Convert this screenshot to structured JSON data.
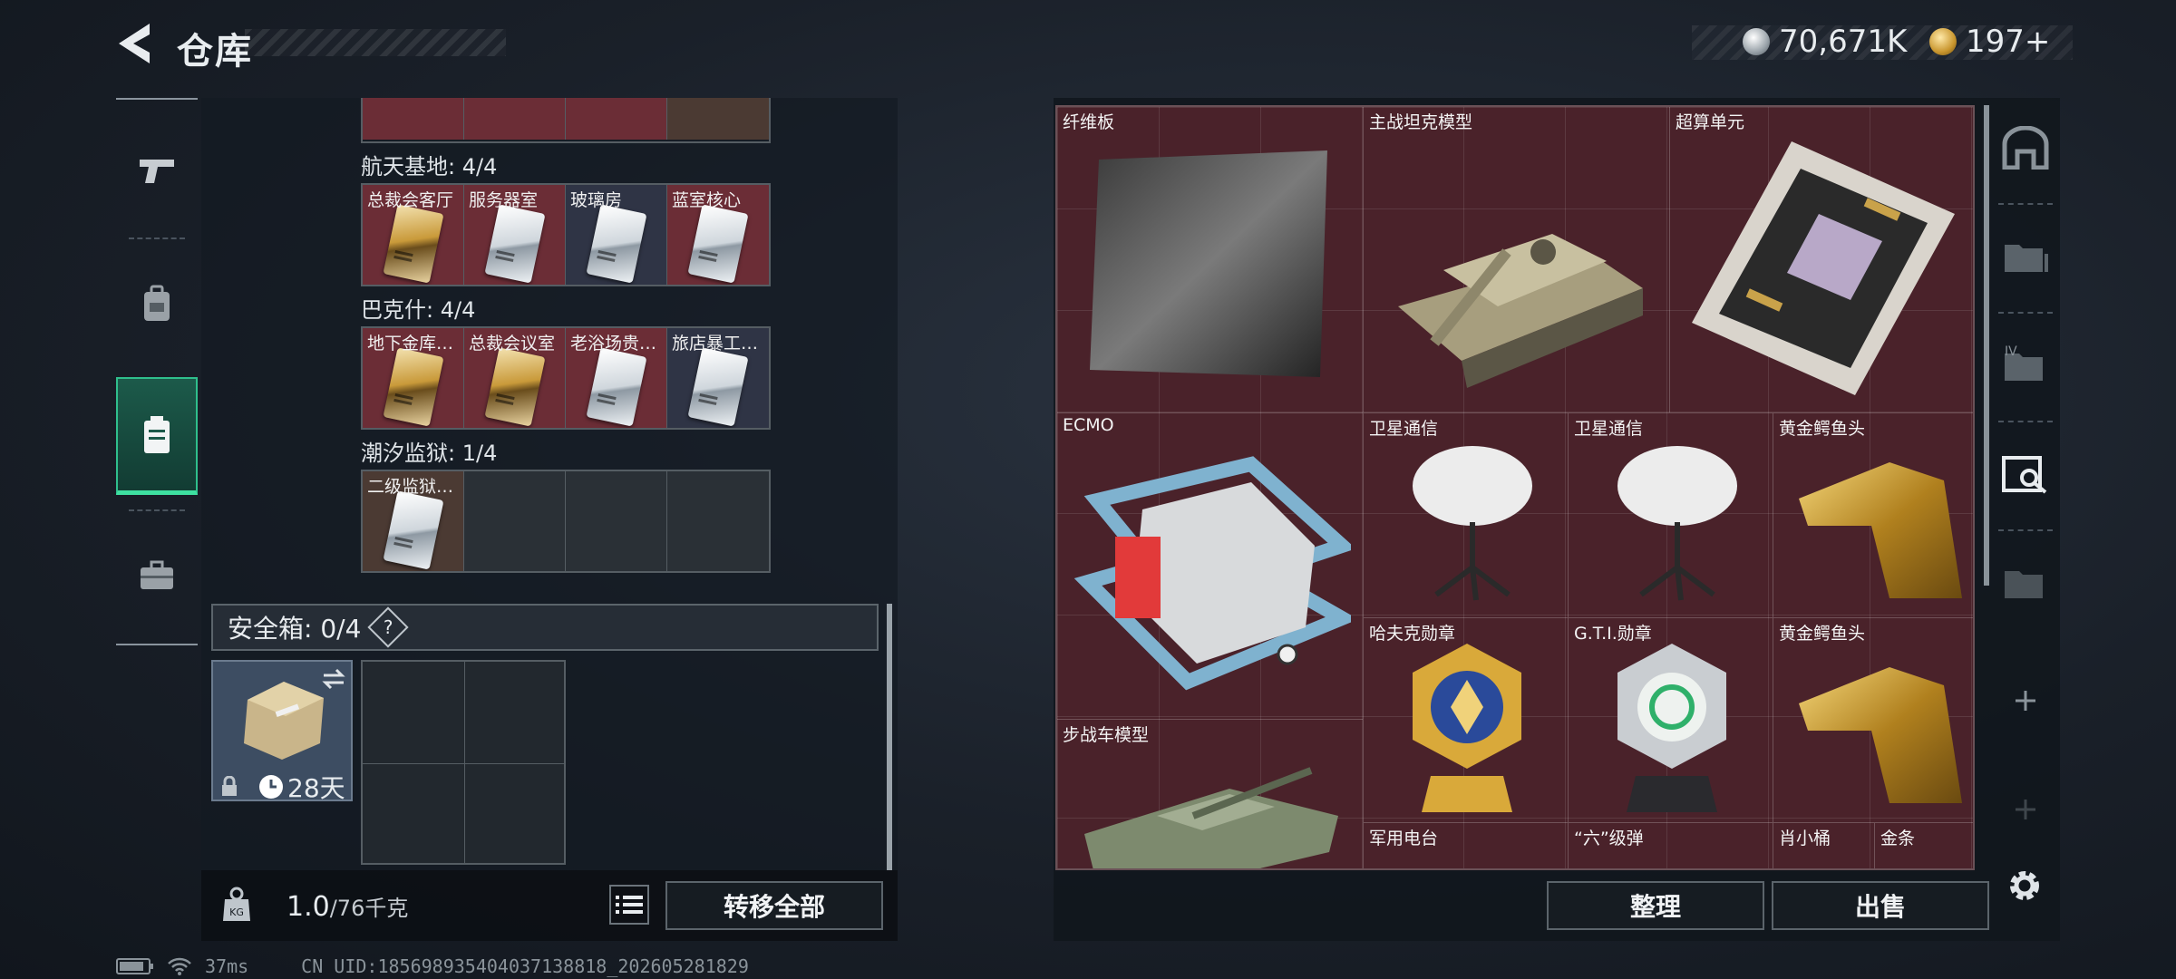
{
  "header": {
    "title": "仓库"
  },
  "currency": {
    "coins": "70,671K",
    "tokens": "197+"
  },
  "left_tabs": [
    "gun-icon",
    "backpack-icon",
    "storage-icon",
    "toolbox-icon"
  ],
  "categories": [
    {
      "label": "航天基地: 4/4",
      "cards": [
        {
          "name": "总裁会客厅",
          "bg": "red",
          "card": "gold"
        },
        {
          "name": "服务器室",
          "bg": "red",
          "card": "white"
        },
        {
          "name": "玻璃房",
          "bg": "blue",
          "card": "white"
        },
        {
          "name": "蓝室核心",
          "bg": "red",
          "card": "white"
        }
      ]
    },
    {
      "label": "巴克什: 4/4",
      "cards": [
        {
          "name": "地下金库…",
          "bg": "red",
          "card": "gold"
        },
        {
          "name": "总裁会议室",
          "bg": "red",
          "card": "gold"
        },
        {
          "name": "老浴场贵…",
          "bg": "red",
          "card": "white"
        },
        {
          "name": "旅店暴工…",
          "bg": "blue",
          "card": "white"
        }
      ]
    },
    {
      "label": "潮汐监狱: 1/4",
      "cards": [
        {
          "name": "二级监狱…",
          "bg": "brown",
          "card": "white"
        },
        {
          "name": "",
          "bg": "empty",
          "card": ""
        },
        {
          "name": "",
          "bg": "empty",
          "card": ""
        },
        {
          "name": "",
          "bg": "empty",
          "card": ""
        }
      ]
    }
  ],
  "safe_box": {
    "label": "安全箱: 0/4",
    "help": "?",
    "duration": "28天"
  },
  "weight": {
    "current": "1.0",
    "max": "/76千克"
  },
  "buttons": {
    "transfer_all": "转移全部",
    "organize": "整理",
    "sell": "出售"
  },
  "status": {
    "ping": "37ms",
    "uid": "CN UID:1856989354040371388​18_202605281829"
  },
  "items": [
    {
      "name": "纤维板",
      "kind": "fiber-board"
    },
    {
      "name": "主战坦克模型",
      "kind": "tank-model"
    },
    {
      "name": "超算单元",
      "kind": "supercomputer-unit"
    },
    {
      "name": "ECMO",
      "kind": "ecmo-machine"
    },
    {
      "name": "卫星通信",
      "kind": "satellite-dish"
    },
    {
      "name": "卫星通信",
      "kind": "satellite-dish"
    },
    {
      "name": "黄金鳄鱼头",
      "kind": "gold-croc-head"
    },
    {
      "name": "哈夫克勋章",
      "kind": "haavk-medal"
    },
    {
      "name": "G.T.I.勋章",
      "kind": "gti-medal"
    },
    {
      "name": "黄金鳄鱼头",
      "kind": "gold-croc-head"
    },
    {
      "name": "步战车模型",
      "kind": "ifv-model"
    },
    {
      "name": "军用电台",
      "kind": "military-radio"
    },
    {
      "name": "“六”级弹",
      "kind": "ammo"
    },
    {
      "name": "肖小桶",
      "kind": "bucket"
    },
    {
      "name": "金条",
      "kind": "gold-bar"
    }
  ]
}
